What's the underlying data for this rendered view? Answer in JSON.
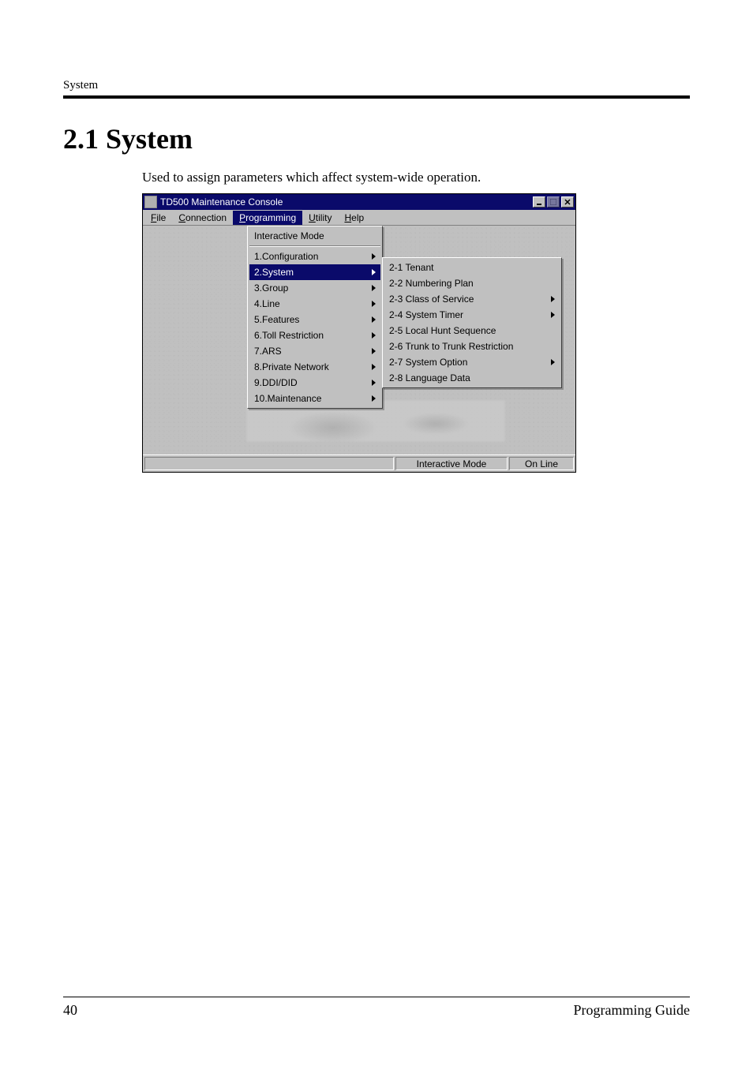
{
  "page": {
    "header_label": "System",
    "heading": "2.1   System",
    "description": "Used to assign parameters which affect system-wide operation.",
    "footer_page": "40",
    "footer_title": "Programming Guide"
  },
  "window": {
    "title": "TD500 Maintenance Console",
    "menubar": {
      "file": "File",
      "connection": "Connection",
      "programming": "Programming",
      "utility": "Utility",
      "help": "Help"
    },
    "programming_menu": {
      "interactive_mode": "Interactive Mode",
      "items": [
        {
          "label": "1.Configuration",
          "submenu": true
        },
        {
          "label": "2.System",
          "submenu": true,
          "highlight": true
        },
        {
          "label": "3.Group",
          "submenu": true
        },
        {
          "label": "4.Line",
          "submenu": true
        },
        {
          "label": "5.Features",
          "submenu": true
        },
        {
          "label": "6.Toll Restriction",
          "submenu": true
        },
        {
          "label": "7.ARS",
          "submenu": true
        },
        {
          "label": "8.Private Network",
          "submenu": true
        },
        {
          "label": "9.DDI/DID",
          "submenu": true
        },
        {
          "label": "10.Maintenance",
          "submenu": true
        }
      ]
    },
    "system_submenu": [
      {
        "label": "2-1 Tenant",
        "submenu": false
      },
      {
        "label": "2-2 Numbering Plan",
        "submenu": false
      },
      {
        "label": "2-3 Class of Service",
        "submenu": true
      },
      {
        "label": "2-4 System Timer",
        "submenu": true
      },
      {
        "label": "2-5 Local Hunt Sequence",
        "submenu": false
      },
      {
        "label": "2-6 Trunk to Trunk Restriction",
        "submenu": false
      },
      {
        "label": "2-7 System Option",
        "submenu": true
      },
      {
        "label": "2-8 Language Data",
        "submenu": false
      }
    ],
    "statusbar": {
      "mode": "Interactive Mode",
      "connection": "On Line"
    }
  }
}
